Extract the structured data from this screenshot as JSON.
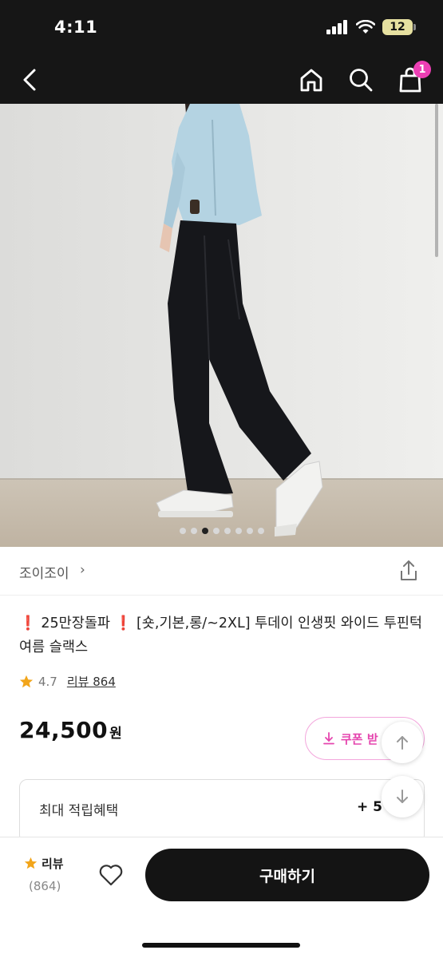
{
  "status_bar": {
    "time": "4:11",
    "battery": "12"
  },
  "header": {
    "cart_count": "1"
  },
  "gallery": {
    "dot_count": 8,
    "active_index": 2
  },
  "brand": {
    "name": "조이조이",
    "chevron": "›"
  },
  "product": {
    "title_badge_1": "❗",
    "title_part_1": " 25만장돌파 ",
    "title_badge_2": "❗",
    "title_part_2": " [숏,기본,롱/~2XL] 투데이 인생핏 와이드 투핀턱 여름 슬랙스",
    "rating": "4.7",
    "review_label": "리뷰 864",
    "price": "24,500",
    "price_unit": "원"
  },
  "coupon": {
    "label": "쿠폰 받"
  },
  "benefit": {
    "label": "최대 적립혜택",
    "value": "+ 5"
  },
  "bottom": {
    "review_label": "리뷰",
    "review_count": "(864)",
    "buy_label": "구매하기"
  },
  "icons": [
    "back-icon",
    "home-icon",
    "search-icon",
    "cart-icon",
    "share-icon",
    "star-icon",
    "download-icon",
    "arrow-up-icon",
    "arrow-down-icon",
    "heart-icon"
  ],
  "colors": {
    "header_bg": "#161616",
    "accent_pink": "#e545ae",
    "badge_pink": "#ec3fb4",
    "star": "#f2a51a",
    "buy_bg": "#141414"
  }
}
